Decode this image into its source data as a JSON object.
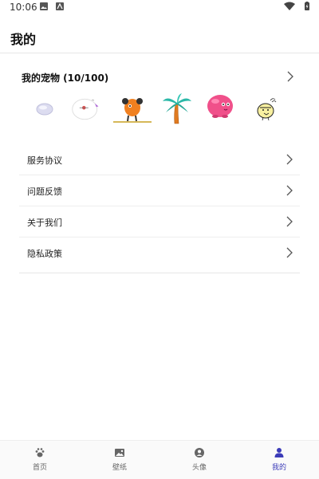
{
  "status": {
    "time": "10:06"
  },
  "header": {
    "title": "我的"
  },
  "pets": {
    "title": "我的宠物 (10/100)",
    "items": [
      {
        "name": "pebble-pet-icon"
      },
      {
        "name": "orbit-pet-icon"
      },
      {
        "name": "orange-creature-pet-icon"
      },
      {
        "name": "palm-tree-pet-icon"
      },
      {
        "name": "pink-blob-pet-icon"
      },
      {
        "name": "bird-pet-icon"
      }
    ]
  },
  "menu": {
    "items": [
      {
        "label": "服务协议"
      },
      {
        "label": "问题反馈"
      },
      {
        "label": "关于我们"
      },
      {
        "label": "隐私政策"
      }
    ]
  },
  "nav": {
    "items": [
      {
        "label": "首页",
        "icon": "paw-icon"
      },
      {
        "label": "壁纸",
        "icon": "image-icon"
      },
      {
        "label": "头像",
        "icon": "avatar-icon"
      },
      {
        "label": "我的",
        "icon": "person-icon",
        "active": true
      }
    ]
  },
  "colors": {
    "accent": "#3b3bb8",
    "nav_inactive": "#666666"
  }
}
